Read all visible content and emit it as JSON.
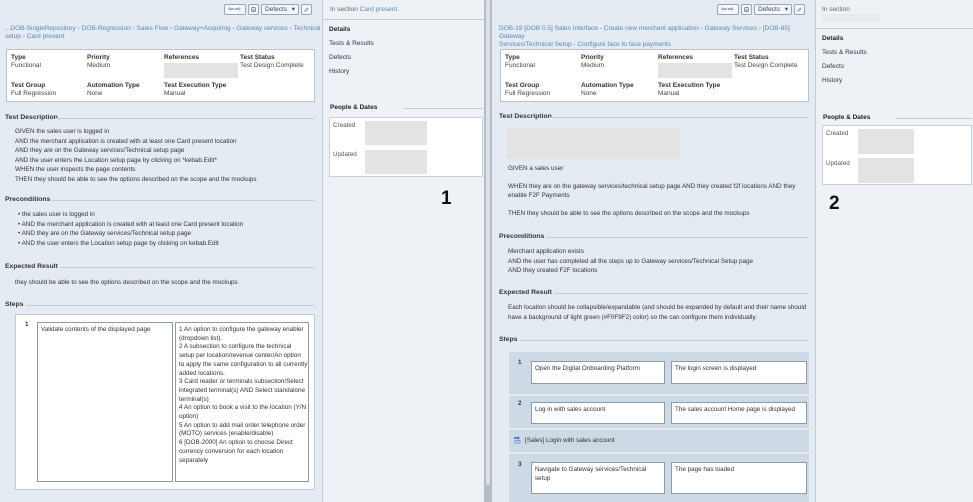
{
  "left": {
    "toolbar": {
      "nav": "⇦⇨",
      "page_icon": "page-icon",
      "filter_label": "Defects",
      "filter_caret": "▾",
      "edit_icon": "pencil-icon"
    },
    "breadcrumb": {
      "line1": [
        "...DOB-SingleRepository",
        "DOB-Regression",
        "Sales Flow",
        "Gateway+Acquiring",
        "Gateway services",
        "Technical"
      ],
      "line2": [
        "setup",
        "Card present"
      ]
    },
    "fields": {
      "type": {
        "label": "Type",
        "value": "Functional"
      },
      "priority": {
        "label": "Priority",
        "value": "Medium"
      },
      "references": {
        "label": "References"
      },
      "test_status": {
        "label": "Test Status",
        "value": "Test Design Complete"
      },
      "test_group": {
        "label": "Test Group",
        "value": "Full Regression"
      },
      "automation_type": {
        "label": "Automation Type",
        "value": "None"
      },
      "execution_type": {
        "label": "Test Execution Type",
        "value": "Manual"
      }
    },
    "description": {
      "title": "Test Description",
      "lines": [
        "GIVEN the sales user is logged in",
        "AND the merchant application is created with at least one Card present location",
        "AND they are on the Gateway services/Technical setup page",
        "AND the user enters the Location setup page by clicking on *kebab.Edit*",
        "WHEN the user inspects the page contents",
        "THEN they should be able to see the options described on the scope and the mockups"
      ]
    },
    "preconditions": {
      "title": "Preconditions",
      "lines": [
        "the sales user is logged in",
        "AND the merchant application is created with at least one Card present location",
        "AND they are on the Gateway services/Technical setup page",
        "AND the user enters the Location setup page by clicking on kebab.Edit"
      ]
    },
    "expected": {
      "title": "Expected Result",
      "lines": [
        "they should be able to see the options described on the scope and the mockups"
      ]
    },
    "steps": {
      "title": "Steps",
      "items": [
        {
          "num": "1",
          "action": "Validate contents of the displayed page",
          "result_lines": [
            "1 An option to configure the gateway enabler",
            "(dropdown list).",
            "2 A subsection to configure the technical",
            "setup per location/revenue center/An option",
            "to apply the same configuration to all currently",
            "added locations.",
            "3 Card reader or terminals subsection/Select",
            "integrated terminal(s) AND Select standalone",
            "terminal(s)",
            "4 An option to book a visit to the location (Y/N",
            "option)",
            "5 An option to add mail order telephone order",
            "(MOTO) services (enable/disable)",
            "6 [DOB-2000] An option to choose Direct",
            "currency conversion for each location",
            "separately"
          ]
        }
      ]
    },
    "side": {
      "in_section_prefix": "In section",
      "in_section_link": "Card present",
      "in_section_suffix": ".",
      "tabs": [
        "Details",
        "Tests & Results",
        "Defects",
        "History"
      ],
      "people_title": "People & Dates",
      "created": "Created",
      "updated": "Updated"
    },
    "marker": "1"
  },
  "right": {
    "toolbar": {
      "nav": "⇦⇨",
      "page_icon": "page-icon",
      "filter_label": "Defects",
      "filter_caret": "▾",
      "edit_icon": "pencil-icon"
    },
    "breadcrumb": {
      "line1": [
        "DOB-19 [DOB 0.5] Sales Interface - Create new merchant application",
        "Gateway Services",
        "[DOB-65] Gateway"
      ],
      "line2": [
        "Services/Technical Setup - Configure face to face payments"
      ]
    },
    "fields": {
      "type": {
        "label": "Type",
        "value": "Functional"
      },
      "priority": {
        "label": "Priority",
        "value": "Medium"
      },
      "references": {
        "label": "References"
      },
      "test_status": {
        "label": "Test Status",
        "value": "Test Design Complete"
      },
      "test_group": {
        "label": "Test Group",
        "value": "Full Regression"
      },
      "automation_type": {
        "label": "Automation Type",
        "value": "None"
      },
      "execution_type": {
        "label": "Test Execution Type",
        "value": "Manual"
      }
    },
    "description": {
      "title": "Test Description",
      "given": "GIVEN a sales user",
      "when_lines": [
        "WHEN they are on the gateway services/technical setup page AND they created f2f locations AND they",
        "enable F2F Payments"
      ],
      "then": "THEN they should be able to see the options described on the scope and the mockups"
    },
    "preconditions": {
      "title": "Preconditions",
      "lines": [
        "Merchant application exists",
        "AND the user has completed all the steps up to Gateway services/Technical Setup page",
        "AND they created F2F locations"
      ]
    },
    "expected": {
      "title": "Expected Result",
      "lines": [
        "Each location should be collapsible/expandable (and should be expanded by default and their name should",
        "have a background of light green (#F0F9F2) color) so the can configure them individually."
      ]
    },
    "steps": {
      "title": "Steps",
      "items": [
        {
          "num": "1",
          "action": "Open the Digital Onboarding Platform",
          "result": "The login screen is displayed"
        },
        {
          "num": "2",
          "action": "Log in with sales account",
          "result": "The sales account Home page is displayed"
        },
        {
          "num": "3",
          "action": "Navigate to Gateway services/Technical setup",
          "result": "The page has loaded"
        }
      ],
      "shared_step": {
        "icon": "shared-step-icon",
        "label": "[Sales] Login with sales account"
      }
    },
    "side": {
      "in_section_prefix": "In section",
      "tabs": [
        "Details",
        "Tests & Results",
        "Defects",
        "History"
      ],
      "people_title": "People & Dates",
      "created": "Created",
      "updated": "Updated"
    },
    "marker": "2"
  }
}
